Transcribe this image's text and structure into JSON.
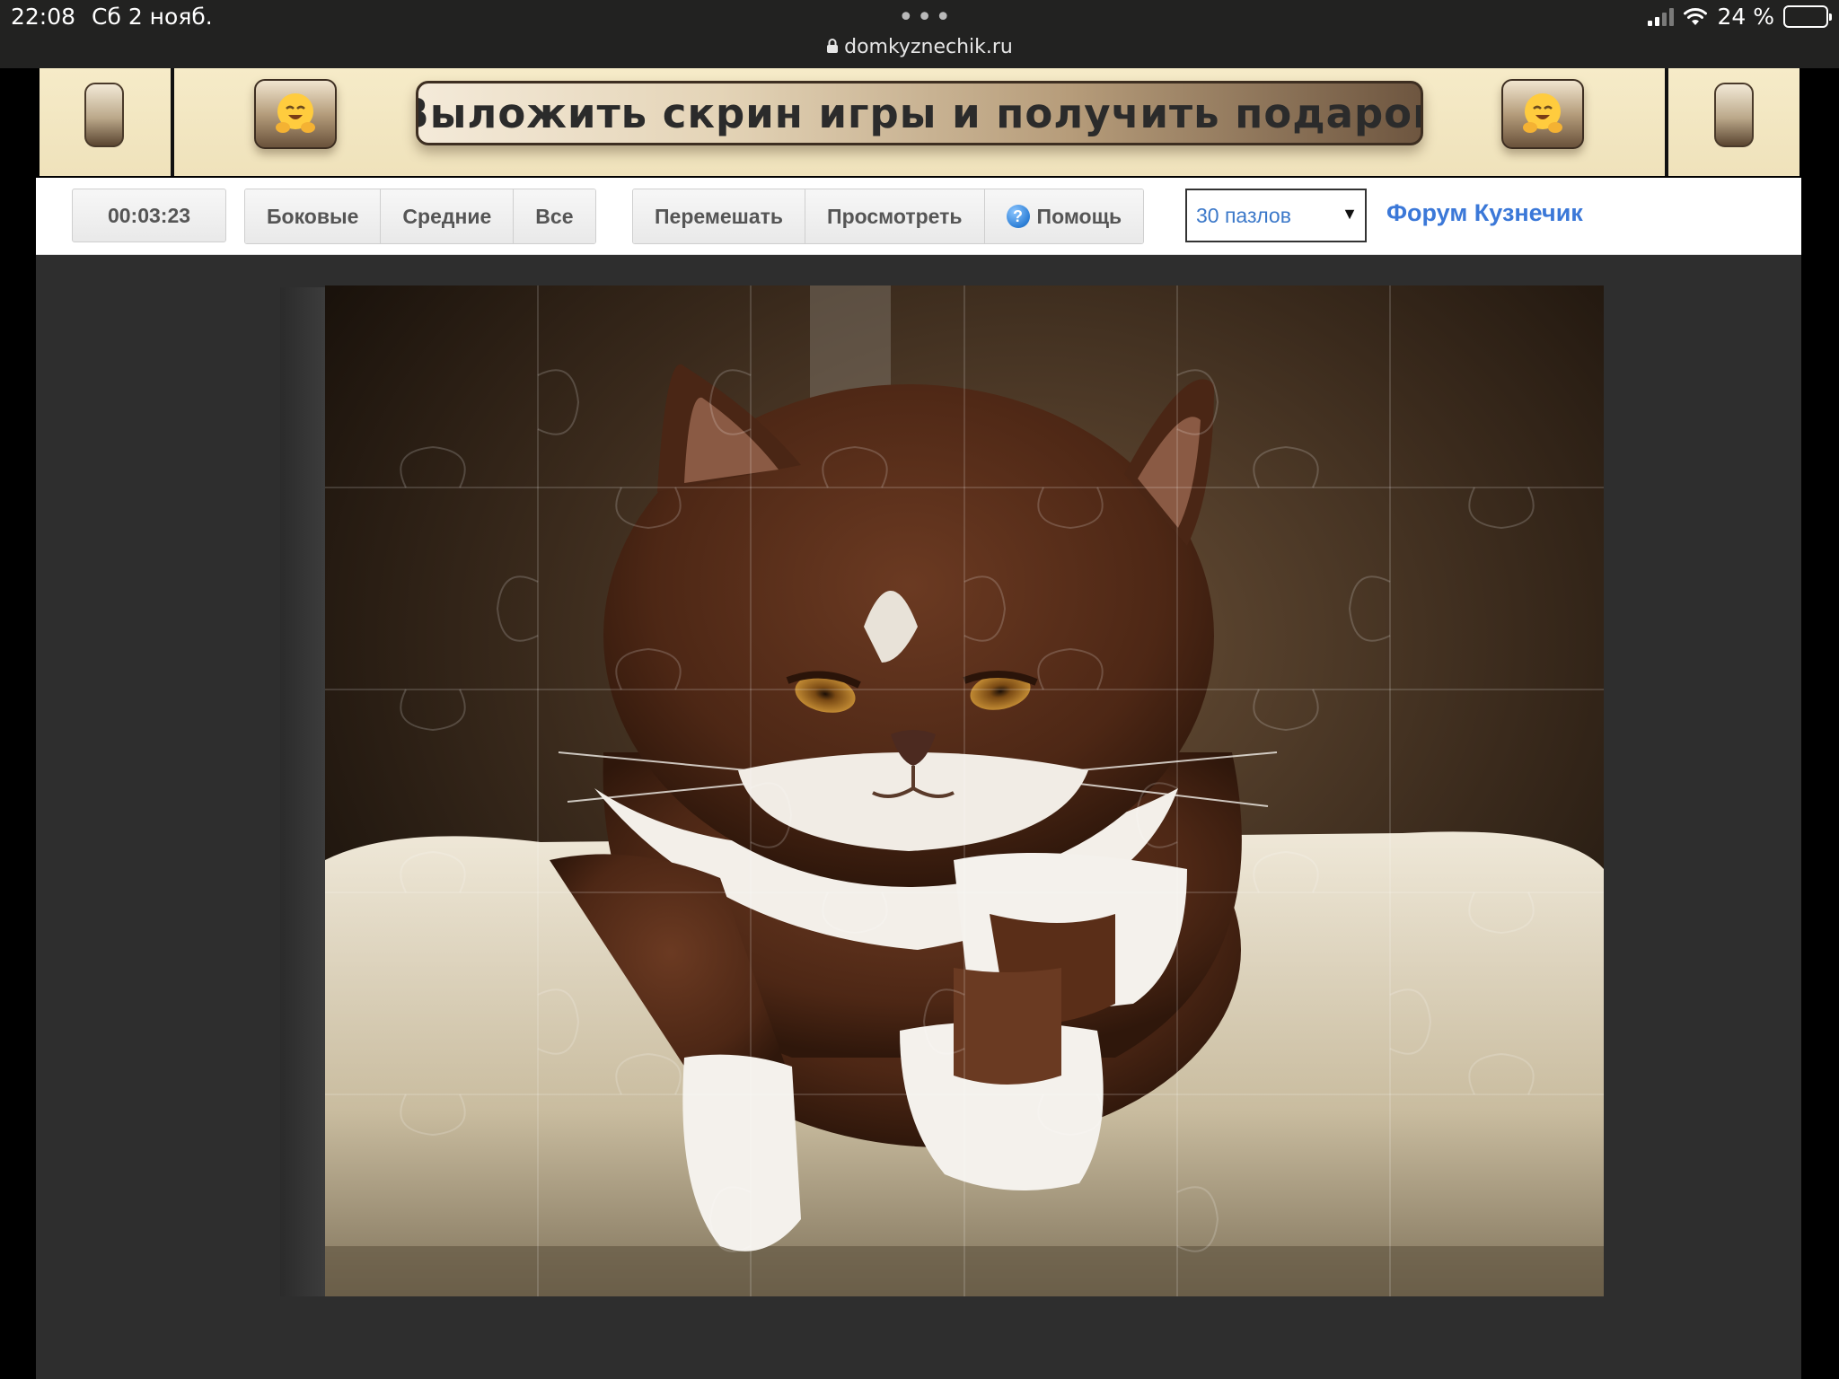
{
  "status_bar": {
    "time": "22:08",
    "date": "Сб 2 нояб.",
    "url": "domkyznechik.ru",
    "battery": "24 %"
  },
  "banner": {
    "title": "Выложить скрин игры и получить подарок",
    "emoji": "🤗"
  },
  "toolbar": {
    "timer": "00:03:23",
    "filter_buttons": [
      "Боковые",
      "Средние",
      "Все"
    ],
    "shuffle": "Перемешать",
    "preview": "Просмотреть",
    "help": "Помощь",
    "help_icon_glyph": "?",
    "pieces_select": "30 пазлов",
    "forum_link": "Форум Кузнечик"
  },
  "puzzle": {
    "columns": 6,
    "rows": 5,
    "subject": "brown-and-white cat on a cream cushion"
  },
  "colors": {
    "link": "#3b78d8",
    "select_text": "#3b78c9",
    "board_bg": "#2e2e2e",
    "banner_bg": "#f6ebc8"
  }
}
